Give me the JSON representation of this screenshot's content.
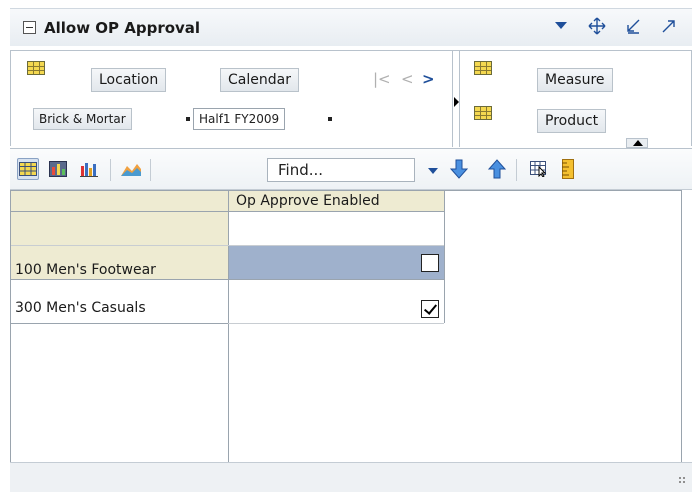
{
  "window": {
    "title": "Allow OP Approval"
  },
  "pivot": {
    "row_dims": [
      "Location",
      "Calendar"
    ],
    "selectors": [
      {
        "label": "Brick & Mortar"
      },
      {
        "label": "Half1 FY2009"
      }
    ],
    "col_dims": [
      "Measure",
      "Product"
    ]
  },
  "toolbar": {
    "find_placeholder": "Find..."
  },
  "table": {
    "column_header": "Op Approve Enabled",
    "rows": [
      {
        "label": "100 Men's Footwear",
        "checked": false
      },
      {
        "label": "300 Men's Casuals",
        "checked": true
      }
    ]
  },
  "colors": {
    "accent": "#1f4f9a",
    "selected_cell": "#9fb1cc",
    "header_bg": "#eeebd2"
  }
}
